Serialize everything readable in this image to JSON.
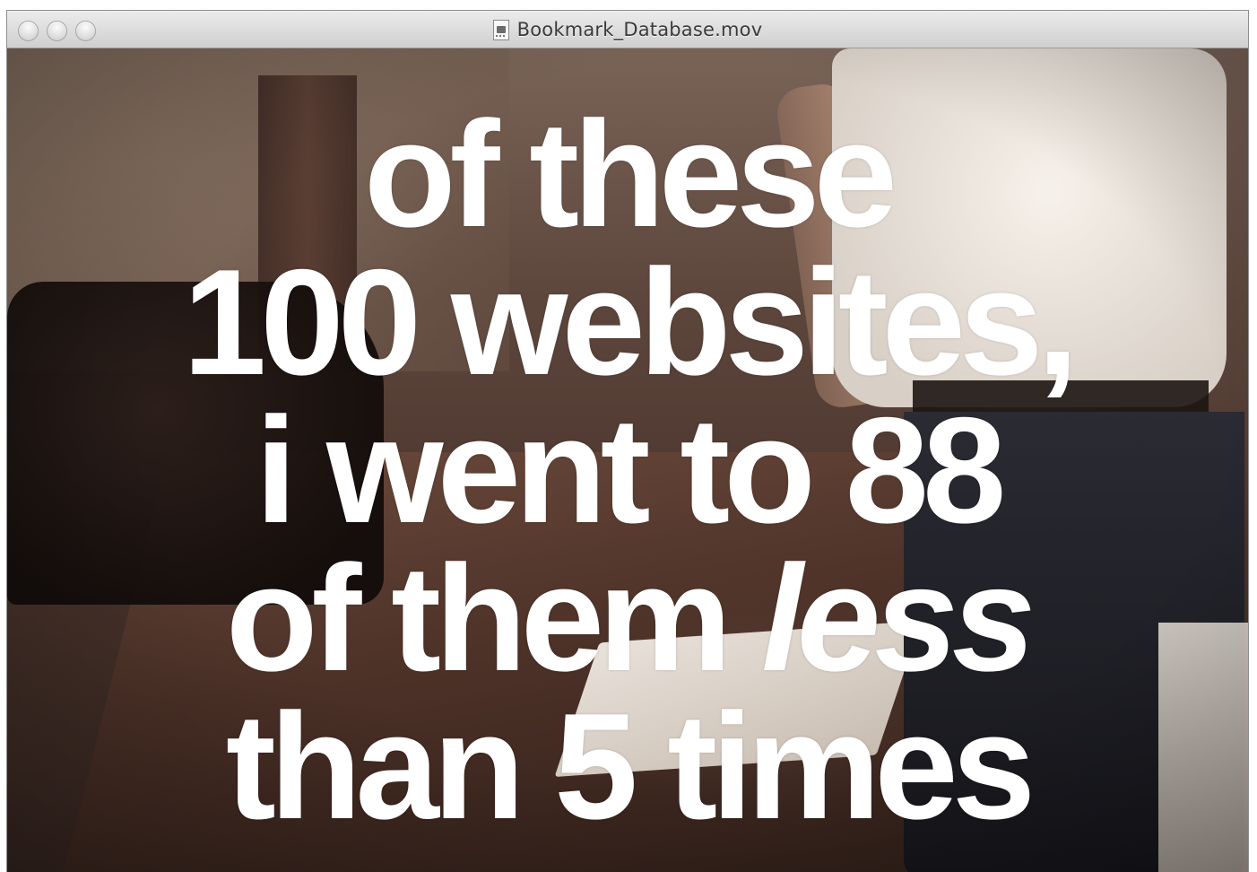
{
  "window": {
    "title": "Bookmark_Database.mov",
    "title_icon": "movie-document-icon",
    "buttons": [
      "close",
      "minimize",
      "zoom"
    ]
  },
  "video": {
    "caption": {
      "line1": "of these",
      "line2": "100 websites,",
      "line3": "i went to 88",
      "line4_start": "of them ",
      "line4_emphasis": "less",
      "line5": "than 5 times"
    }
  }
}
